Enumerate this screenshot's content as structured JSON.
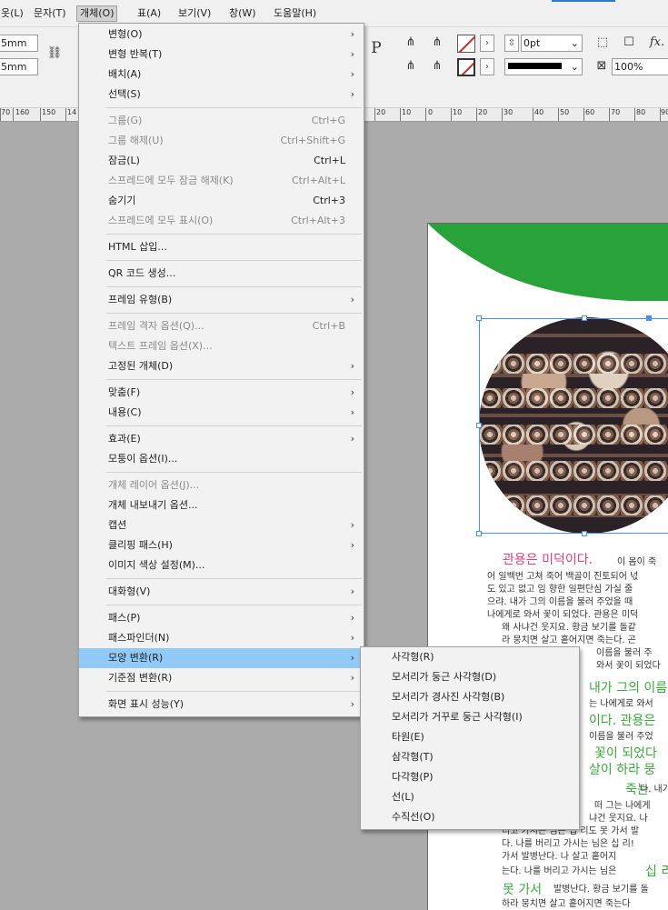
{
  "menubar": {
    "items": [
      {
        "label": "옷(L)"
      },
      {
        "label": "문자(T)"
      },
      {
        "label": "개체(O)"
      },
      {
        "label": "표(A)"
      },
      {
        "label": "보기(V)"
      },
      {
        "label": "창(W)"
      },
      {
        "label": "도움말(H)"
      }
    ]
  },
  "controlbar": {
    "width_value": "5mm",
    "height_value": "5mm",
    "stroke_weight": "0pt",
    "opacity": "100%",
    "text_frame_glyph": "P",
    "fx_label": "fx."
  },
  "ruler": {
    "ticks": [
      "70",
      "160",
      "150",
      "14",
      "20",
      "10",
      "0",
      "10",
      "20",
      "30",
      "40",
      "50",
      "60",
      "70",
      "80",
      "90"
    ]
  },
  "object_menu": {
    "items": [
      {
        "label": "변형(O)",
        "shortcut": "",
        "submenu": true,
        "disabled": false
      },
      {
        "label": "변형 반복(T)",
        "shortcut": "",
        "submenu": true,
        "disabled": false
      },
      {
        "label": "배치(A)",
        "shortcut": "",
        "submenu": true,
        "disabled": false
      },
      {
        "label": "선택(S)",
        "shortcut": "",
        "submenu": true,
        "disabled": false
      },
      {
        "label": "그룹(G)",
        "shortcut": "Ctrl+G",
        "submenu": false,
        "disabled": true
      },
      {
        "label": "그룹 해제(U)",
        "shortcut": "Ctrl+Shift+G",
        "submenu": false,
        "disabled": true
      },
      {
        "label": "잠금(L)",
        "shortcut": "Ctrl+L",
        "submenu": false,
        "disabled": false
      },
      {
        "label": "스프레드에 모두 잠금 해제(K)",
        "shortcut": "Ctrl+Alt+L",
        "submenu": false,
        "disabled": true
      },
      {
        "label": "숨기기",
        "shortcut": "Ctrl+3",
        "submenu": false,
        "disabled": false
      },
      {
        "label": "스프레드에 모두 표시(O)",
        "shortcut": "Ctrl+Alt+3",
        "submenu": false,
        "disabled": true
      },
      {
        "label": "HTML 삽입...",
        "shortcut": "",
        "submenu": false,
        "disabled": false
      },
      {
        "label": "QR 코드 생성...",
        "shortcut": "",
        "submenu": false,
        "disabled": false
      },
      {
        "label": "프레임 유형(B)",
        "shortcut": "",
        "submenu": true,
        "disabled": false
      },
      {
        "label": "프레임 격자 옵션(Q)...",
        "shortcut": "Ctrl+B",
        "submenu": false,
        "disabled": true
      },
      {
        "label": "텍스트 프레임 옵션(X)...",
        "shortcut": "",
        "submenu": false,
        "disabled": true
      },
      {
        "label": "고정된 개체(D)",
        "shortcut": "",
        "submenu": true,
        "disabled": false
      },
      {
        "label": "맞춤(F)",
        "shortcut": "",
        "submenu": true,
        "disabled": false
      },
      {
        "label": "내용(C)",
        "shortcut": "",
        "submenu": true,
        "disabled": false
      },
      {
        "label": "효과(E)",
        "shortcut": "",
        "submenu": true,
        "disabled": false
      },
      {
        "label": "모퉁이 옵션(I)...",
        "shortcut": "",
        "submenu": false,
        "disabled": false
      },
      {
        "label": "개체 레이어 옵션(J)...",
        "shortcut": "",
        "submenu": false,
        "disabled": true
      },
      {
        "label": "개체 내보내기 옵션...",
        "shortcut": "",
        "submenu": false,
        "disabled": false
      },
      {
        "label": "캡션",
        "shortcut": "",
        "submenu": true,
        "disabled": false
      },
      {
        "label": "클리핑 패스(H)",
        "shortcut": "",
        "submenu": true,
        "disabled": false
      },
      {
        "label": "이미지 색상 설정(M)...",
        "shortcut": "",
        "submenu": false,
        "disabled": false
      },
      {
        "label": "대화형(V)",
        "shortcut": "",
        "submenu": true,
        "disabled": false
      },
      {
        "label": "패스(P)",
        "shortcut": "",
        "submenu": true,
        "disabled": false
      },
      {
        "label": "패스파인더(N)",
        "shortcut": "",
        "submenu": true,
        "disabled": false
      },
      {
        "label": "모양 변환(R)",
        "shortcut": "",
        "submenu": true,
        "disabled": false,
        "highlighted": true
      },
      {
        "label": "기준점 변환(R)",
        "shortcut": "",
        "submenu": true,
        "disabled": false
      },
      {
        "label": "화면 표시 성능(Y)",
        "shortcut": "",
        "submenu": true,
        "disabled": false
      }
    ]
  },
  "convert_shape_submenu": {
    "items": [
      {
        "label": "사각형(R)"
      },
      {
        "label": "모서리가 둥근 사각형(D)"
      },
      {
        "label": "모서리가 경사진 사각형(B)"
      },
      {
        "label": "모서리가 거꾸로 둥근 사각형(I)"
      },
      {
        "label": "타원(E)"
      },
      {
        "label": "삼각형(T)"
      },
      {
        "label": "다각형(P)"
      },
      {
        "label": "선(L)"
      },
      {
        "label": "수직선(O)"
      }
    ]
  },
  "document": {
    "heading": "관용은 미덕이다.",
    "heading_tail": "이 몸이 죽",
    "body_lines": [
      "어 일백번 고쳐 죽어 백골이 진토되어 넋",
      "도 있고 없고 임 향한 일편단심 가실 줄",
      "으랴. 내가 그의 이름을 불러 주었을 때",
      "나에게로 와서 꽃이 되었다. 관용은 미덕",
      "왜 사냐건 웃지요. 황금 보기를 돌같",
      "라 뭉치면 살고 흩어지면 죽는다. 곤",
      "이름을 불러 주",
      "와서 꽃이 되었다",
      "는 나에게로 와서",
      "이름을 불러 주었",
      "떠 그는 나에게",
      "냐건 웃지요. 나",
      "리고 가시는 님은 십 리도 못 가서 발",
      "다. 나를 버리고 가시는 님은 십 리!",
      "가서 발병난다. 나       살고 흩어지",
      "는다. 나를 버리고 가시는 님은",
      "발병난다. 황금 보기를 돌",
      "하라 뭉치면 살고 흩어지면 죽는다"
    ],
    "green_texts": [
      "내가 그의 이름",
      "이다. 관용은",
      "꽃이 되었다",
      "살이 하라 뭉",
      "죽는",
      "다. 내가",
      "십 리",
      "못 가서"
    ]
  },
  "colors": {
    "menu_highlight": "#91c9f7",
    "accent_green": "#2aa23a",
    "heading_pink": "#e0407a",
    "selection_blue": "#4a8ef0"
  }
}
